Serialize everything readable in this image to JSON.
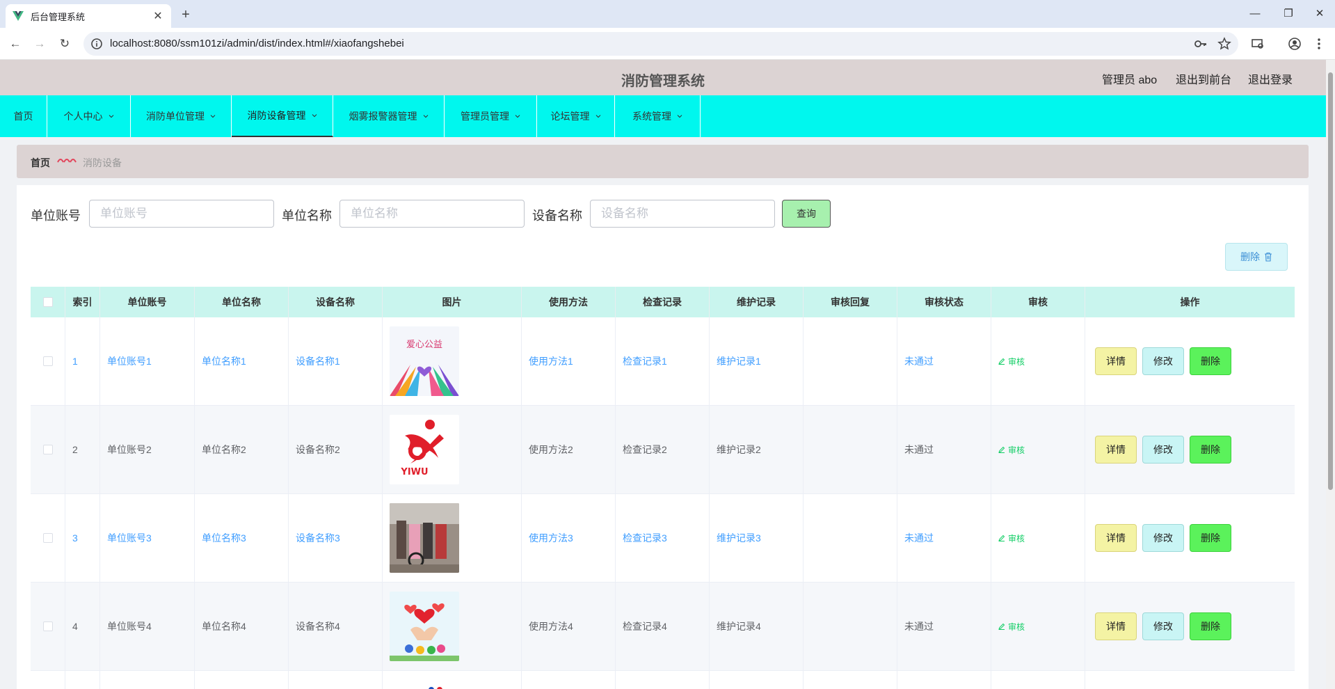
{
  "browser": {
    "tab_title": "后台管理系统",
    "url": "localhost:8080/ssm101zi/admin/dist/index.html#/xiaofangshebei"
  },
  "header": {
    "system_name": "消防管理系统",
    "admin_label": "管理员 abo",
    "to_front": "退出到前台",
    "logout": "退出登录"
  },
  "menu": [
    {
      "label": "首页"
    },
    {
      "label": "个人中心"
    },
    {
      "label": "消防单位管理"
    },
    {
      "label": "消防设备管理"
    },
    {
      "label": "烟雾报警器管理"
    },
    {
      "label": "管理员管理"
    },
    {
      "label": "论坛管理"
    },
    {
      "label": "系统管理"
    }
  ],
  "breadcrumb": {
    "home": "首页",
    "current": "消防设备"
  },
  "search": {
    "unit_account_label": "单位账号",
    "unit_account_placeholder": "单位账号",
    "unit_name_label": "单位名称",
    "unit_name_placeholder": "单位名称",
    "device_name_label": "设备名称",
    "device_name_placeholder": "设备名称",
    "query_button": "查询"
  },
  "toolbar": {
    "delete_label": "删除"
  },
  "table": {
    "columns": [
      "索引",
      "单位账号",
      "单位名称",
      "设备名称",
      "图片",
      "使用方法",
      "检查记录",
      "维护记录",
      "审核回复",
      "审核状态",
      "审核",
      "操作"
    ],
    "audit_label": "审核",
    "detail_label": "详情",
    "edit_label": "修改",
    "delete_label": "删除",
    "rows": [
      {
        "index": "1",
        "account": "单位账号1",
        "unit": "单位名称1",
        "device": "设备名称1",
        "usage": "使用方法1",
        "check": "检查记录1",
        "maintain": "维护记录1",
        "reply": "",
        "status": "未通过",
        "image_caption": "爱心公益"
      },
      {
        "index": "2",
        "account": "单位账号2",
        "unit": "单位名称2",
        "device": "设备名称2",
        "usage": "使用方法2",
        "check": "检查记录2",
        "maintain": "维护记录2",
        "reply": "",
        "status": "未通过",
        "image_caption": "YIWU"
      },
      {
        "index": "3",
        "account": "单位账号3",
        "unit": "单位名称3",
        "device": "设备名称3",
        "usage": "使用方法3",
        "check": "检查记录3",
        "maintain": "维护记录3",
        "reply": "",
        "status": "未通过",
        "image_caption": ""
      },
      {
        "index": "4",
        "account": "单位账号4",
        "unit": "单位名称4",
        "device": "设备名称4",
        "usage": "使用方法4",
        "check": "检查记录4",
        "maintain": "维护记录4",
        "reply": "",
        "status": "未通过",
        "image_caption": ""
      }
    ]
  },
  "colors": {
    "menu_bg": "#00f7ee",
    "header_bg": "#dcd3d3",
    "table_head_bg": "#c9f5ee",
    "link_blue": "#409eff",
    "audit_green": "#13ce66"
  }
}
